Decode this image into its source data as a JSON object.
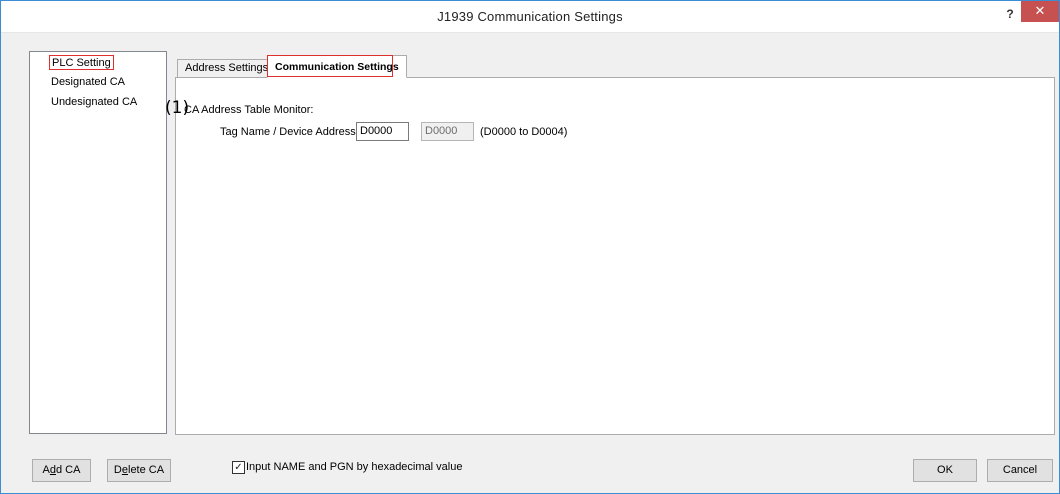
{
  "window": {
    "title": "J1939 Communication Settings",
    "help_glyph": "?",
    "close_glyph": "✕"
  },
  "tree": {
    "items": [
      {
        "label": "PLC Setting",
        "selected": true
      },
      {
        "label": "Designated CA",
        "selected": false
      },
      {
        "label": "Undesignated CA",
        "selected": false
      }
    ]
  },
  "tabs": [
    {
      "label": "Address Settings",
      "active": false
    },
    {
      "label": "Communication Settings",
      "active": true
    }
  ],
  "content": {
    "marker": "(1)",
    "group_label": "CA Address Table Monitor:",
    "field_label": "Tag Name / Device Address:",
    "address_value": "D0000",
    "address_end_value": "D0000",
    "range_text": "(D0000 to D0004)"
  },
  "footer": {
    "add_ca": {
      "pre": "A",
      "accel": "d",
      "post": "d CA"
    },
    "delete_ca": {
      "pre": "D",
      "accel": "e",
      "post": "lete CA"
    },
    "checkbox_label": "Input NAME and PGN by hexadecimal value",
    "checkbox_checked": true,
    "ok_label": "OK",
    "cancel_label": "Cancel"
  },
  "colors": {
    "accent_border": "#3c8dd4",
    "close_button": "#c75050",
    "highlight_red": "#e0302d"
  }
}
